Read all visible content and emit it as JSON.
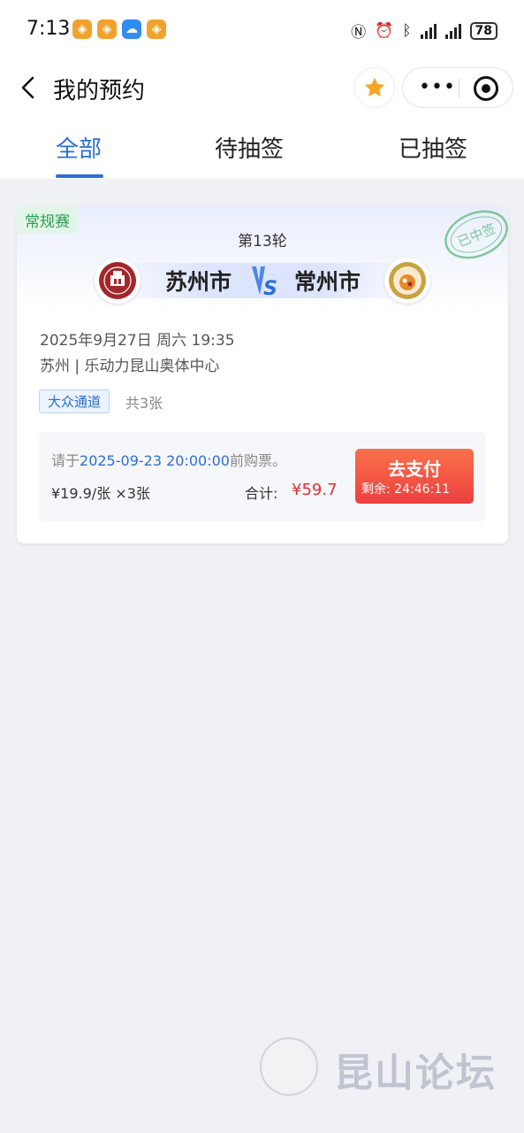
{
  "status_bar": {
    "time": "7:13",
    "battery": "78",
    "signal_icons": [
      "nfc-icon",
      "alarm-icon",
      "bluetooth-icon",
      "signal-icon",
      "signal-icon"
    ]
  },
  "nav": {
    "title": "我的预约",
    "icons": [
      "back-icon",
      "star-icon",
      "more-icon",
      "target-icon"
    ],
    "star_color": "#f5a623"
  },
  "tabs": [
    {
      "label": "全部",
      "active": true
    },
    {
      "label": "待抽签",
      "active": false
    },
    {
      "label": "已抽签",
      "active": false
    }
  ],
  "accent_color": "#2b6fd6",
  "card": {
    "tag": "常规赛",
    "round": "第13轮",
    "home_team": "苏州市",
    "away_team": "常州市",
    "stamp": "已中签",
    "datetime": "2025年9月27日 周六 19:35",
    "venue": "苏州 | 乐动力昆山奥体中心",
    "channel": "大众通道",
    "count": "共3张",
    "pay": {
      "deadline_prefix": "请于",
      "deadline_time": "2025-09-23 20:00:00",
      "deadline_suffix": "前购票。",
      "unit_price": "¥19.9/张 ×3张",
      "total_label": "合计:",
      "total_value": "¥59.7",
      "button_label": "去支付",
      "remaining": "剩余:   24:46:11"
    }
  },
  "watermark": {
    "text": "昆山论坛"
  }
}
